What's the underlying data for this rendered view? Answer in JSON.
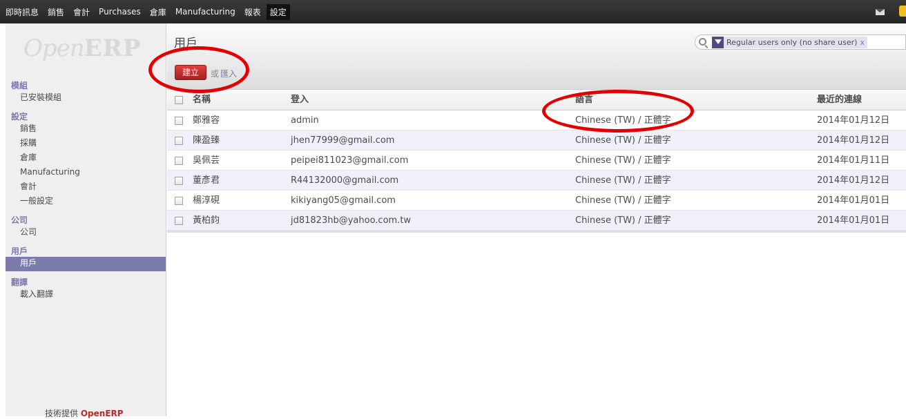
{
  "topnav": {
    "items": [
      "即時訊息",
      "銷售",
      "會計",
      "Purchases",
      "倉庫",
      "Manufacturing",
      "報表",
      "設定"
    ]
  },
  "sidebar": {
    "logo_first": "Open",
    "logo_second": "ERP",
    "sections": [
      {
        "title": "模組",
        "items": [
          "已安裝模組"
        ]
      },
      {
        "title": "設定",
        "items": [
          "銷售",
          "採購",
          "倉庫",
          "Manufacturing",
          "會計",
          "一般設定"
        ]
      },
      {
        "title": "公司",
        "items": [
          "公司"
        ]
      },
      {
        "title": "用戶",
        "items": [
          "用戶"
        ]
      },
      {
        "title": "翻譯",
        "items": [
          "載入翻譯"
        ]
      }
    ],
    "powered_by": "技術提供",
    "powered_brand": "OpenERP"
  },
  "page": {
    "title": "用戶",
    "create_label": "建立",
    "or_label": "或",
    "import_label": "匯入"
  },
  "search": {
    "facet": "Regular users only (no share user)",
    "remove": "x"
  },
  "table": {
    "headers": {
      "name": "名稱",
      "login": "登入",
      "lang": "語言",
      "last": "最近的連線"
    },
    "rows": [
      {
        "name": "鄭雅容",
        "login": "admin",
        "lang": "Chinese (TW) / 正體字",
        "last": "2014年01月12日"
      },
      {
        "name": "陳盈臻",
        "login": "jhen77999@gmail.com",
        "lang": "Chinese (TW) / 正體字",
        "last": "2014年01月12日"
      },
      {
        "name": "吳佩芸",
        "login": "peipei811023@gmail.com",
        "lang": "Chinese (TW) / 正體字",
        "last": "2014年01月11日"
      },
      {
        "name": "董彥君",
        "login": "R44132000@gmail.com",
        "lang": "Chinese (TW) / 正體字",
        "last": "2014年01月12日"
      },
      {
        "name": "楊淳硯",
        "login": "kikiyang05@gmail.com",
        "lang": "Chinese (TW) / 正體字",
        "last": "2014年01月01日"
      },
      {
        "name": "黃柏鈞",
        "login": "jd81823hb@yahoo.com.tw",
        "lang": "Chinese (TW) / 正體字",
        "last": "2014年01月01日"
      }
    ]
  },
  "colors": {
    "accent": "#7c7bad",
    "create_button": "#b92c28",
    "annotation": "#e30000"
  }
}
